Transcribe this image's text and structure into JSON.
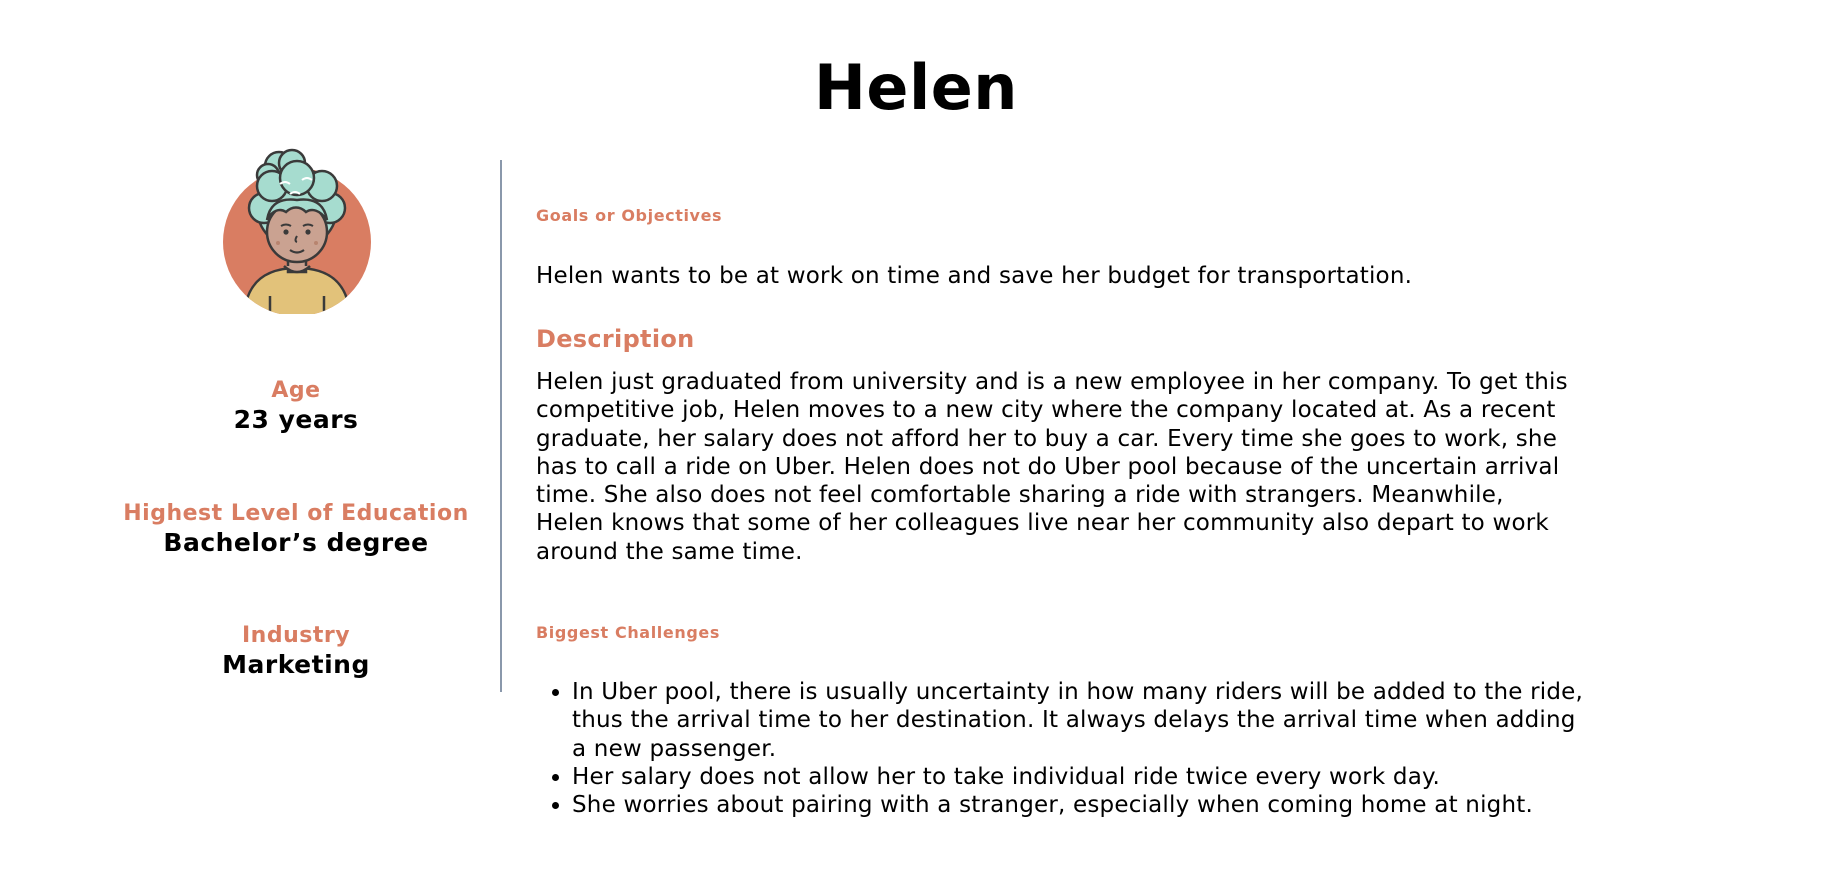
{
  "persona": {
    "name": "Helen"
  },
  "stats": {
    "age_label": "Age",
    "age_value": "23 years",
    "education_label": "Highest Level of Education",
    "education_value": "Bachelor’s degree",
    "industry_label": "Industry",
    "industry_value": "Marketing"
  },
  "goals": {
    "heading": "Goals or Objectives",
    "text": "Helen wants to be at work on time and save her budget for transportation."
  },
  "description": {
    "heading": "Description",
    "text": "Helen just graduated from university and is a new employee in her company. To get this competitive job, Helen moves to a new city where the company located at. As a recent graduate, her salary does not afford her to buy a car. Every time she goes to work, she has to call a ride on Uber. Helen does not do Uber pool because of the uncertain arrival time. She also does not feel comfortable sharing a ride with strangers. Meanwhile, Helen knows that some of her colleagues live near her community also depart to work around the same time."
  },
  "challenges": {
    "heading": "Biggest Challenges",
    "items": [
      "In Uber pool, there is usually uncertainty in how many riders will be added to the ride, thus the arrival time to her destination. It always delays the arrival time when adding a new passenger.",
      "Her salary does not allow her to take individual ride twice every work day.",
      "She worries about pairing with a stranger, especially when coming home at night."
    ]
  },
  "colors": {
    "accent": "#d97d62",
    "divider": "#8a98ab",
    "avatar_bg": "#d97d62",
    "hair": "#a6dccf",
    "skin": "#caa291",
    "shirt": "#e2c27a"
  },
  "icons": {
    "avatar": "woman-avatar-icon"
  }
}
